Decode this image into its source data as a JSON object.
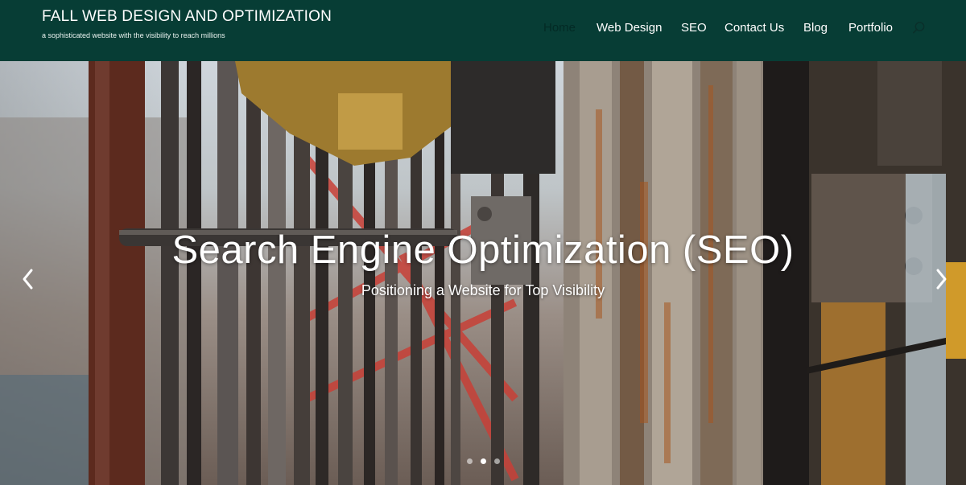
{
  "brand": {
    "title": "FALL WEB DESIGN AND OPTIMIZATION",
    "tagline": "a sophisticated website with the visibility to reach millions"
  },
  "nav": {
    "items": [
      {
        "label": "Home",
        "active": true
      },
      {
        "label": "Web Design"
      },
      {
        "label": "SEO"
      },
      {
        "label": "Contact Us"
      },
      {
        "label": "Blog"
      },
      {
        "label": "Portfolio"
      }
    ],
    "search_icon": "search-icon"
  },
  "slider": {
    "title": "Search Engine Optimization (SEO)",
    "subtitle": "Positioning a Website for Top Visibility",
    "prev_icon": "chevron-left-icon",
    "next_icon": "chevron-right-icon",
    "dots_count": 3,
    "active_dot": 2
  },
  "colors": {
    "header_bg": "#073d35",
    "active_nav": "#032a25",
    "text": "#ffffff"
  }
}
